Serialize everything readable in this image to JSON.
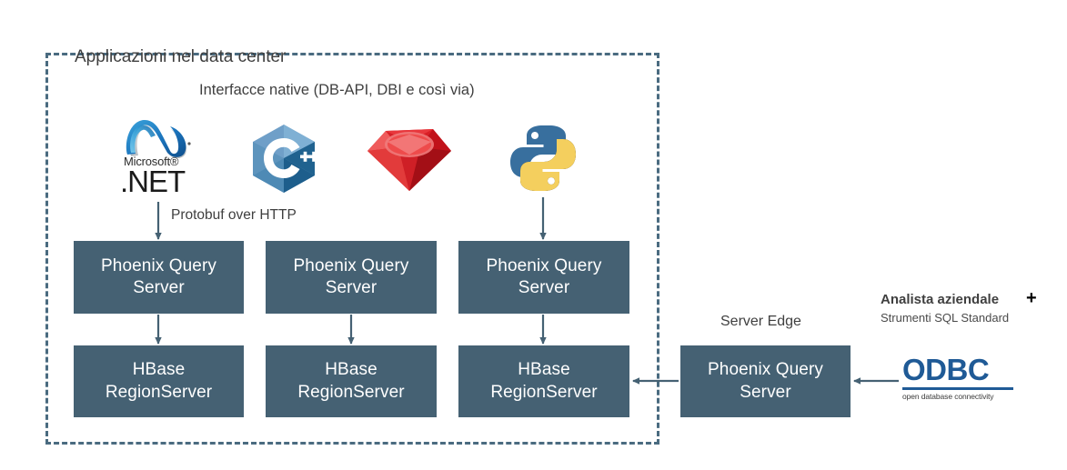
{
  "diagram": {
    "title": "Applicazioni nel data center",
    "native_interfaces_label": "Interfacce native (DB-API, DBI e così via)",
    "protobuf_label": "Protobuf over HTTP",
    "server_edge_label": "Server Edge",
    "analyst_label": "Analista aziendale",
    "analyst_sublabel": "Strumenti SQL Standard",
    "plus_symbol": "+"
  },
  "colors": {
    "node_fill": "#456173",
    "boundary": "#4a6b80",
    "arrow": "#456173",
    "odbc_blue": "#1f5a96",
    "text": "#3f3f3f"
  },
  "logos": [
    {
      "name": "dotnet-logo",
      "vendor_text": "Microsoft®",
      "product_text": ".NET"
    },
    {
      "name": "cplusplus-logo",
      "letter": "C",
      "suffix": "++"
    },
    {
      "name": "ruby-logo",
      "alt": "Ruby"
    },
    {
      "name": "python-logo",
      "alt": "Python"
    },
    {
      "name": "odbc-logo",
      "word": "ODBC",
      "sub": "open database connectivity"
    }
  ],
  "nodes": {
    "pqs": [
      {
        "line1": "Phoenix Query",
        "line2": "Server"
      },
      {
        "line1": "Phoenix Query",
        "line2": "Server"
      },
      {
        "line1": "Phoenix Query",
        "line2": "Server"
      }
    ],
    "hbase": [
      {
        "line1": "HBase",
        "line2": "RegionServer"
      },
      {
        "line1": "HBase",
        "line2": "RegionServer"
      },
      {
        "line1": "HBase",
        "line2": "RegionServer"
      }
    ],
    "edge_pqs": {
      "line1": "Phoenix Query",
      "line2": "Server"
    }
  }
}
